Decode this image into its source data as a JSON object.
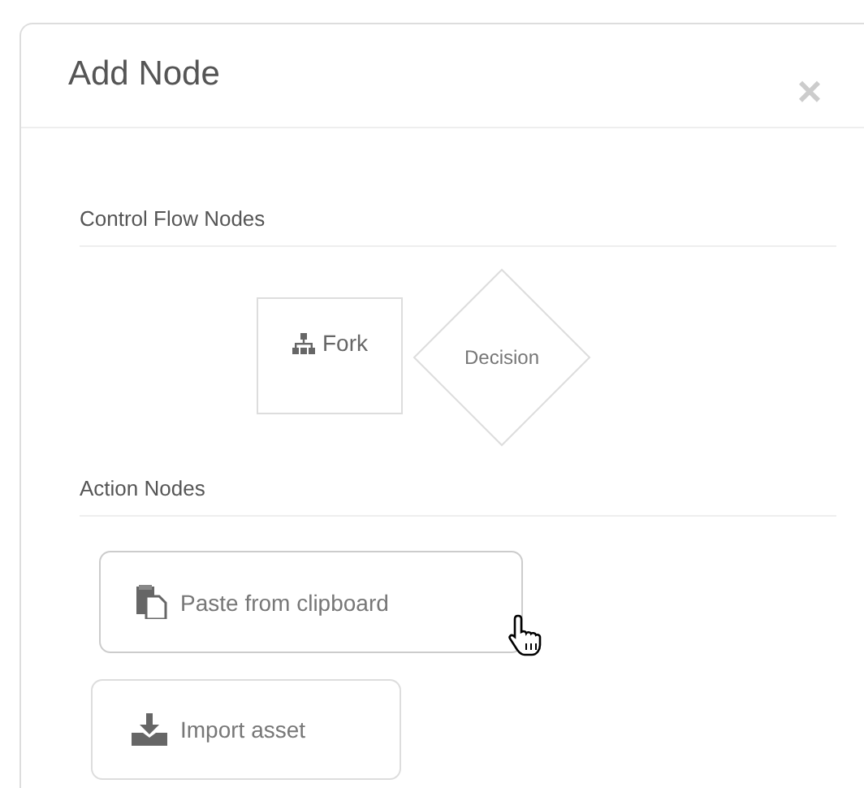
{
  "dialog": {
    "title": "Add Node",
    "close_label": "×"
  },
  "sections": [
    {
      "heading": "Control Flow Nodes",
      "nodes": [
        {
          "kind": "fork",
          "label": "Fork",
          "hovered": false
        },
        {
          "kind": "decision",
          "label": "Decision",
          "hovered": false
        }
      ]
    },
    {
      "heading": "Action Nodes",
      "nodes": [
        {
          "kind": "paste",
          "label": "Paste from clipboard",
          "hovered": true
        },
        {
          "kind": "import",
          "label": "Import asset",
          "hovered": false
        }
      ]
    }
  ]
}
